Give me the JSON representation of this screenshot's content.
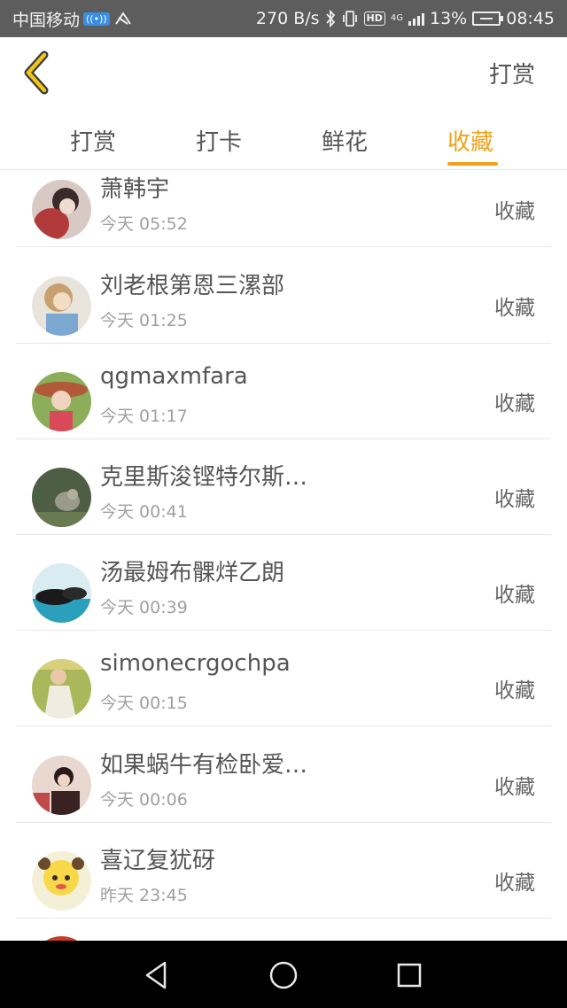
{
  "status_bar": {
    "carrier": "中国移动",
    "carrier_badge": "((•))",
    "speed": "270 B/s",
    "hd": "HD",
    "network": "4G",
    "battery": "13%",
    "time": "08:45"
  },
  "header": {
    "action_label": "打赏",
    "accent_color": "#f0a21b"
  },
  "tabs": [
    {
      "label": "打赏",
      "active": false
    },
    {
      "label": "打卡",
      "active": false
    },
    {
      "label": "鲜花",
      "active": false
    },
    {
      "label": "收藏",
      "active": true
    }
  ],
  "rows": [
    {
      "name": "萧韩宇",
      "time": "今天 05:52",
      "action": "收藏",
      "avatar_color": "#b23a3a"
    },
    {
      "name": "刘老根第恩三漯部",
      "time": "今天 01:25",
      "action": "收藏",
      "avatar_color": "#c9b39a"
    },
    {
      "name": "qgmaxmfara",
      "time": "今天 01:17",
      "action": "收藏",
      "avatar_color": "#7a9a4a"
    },
    {
      "name": "克里斯浚铿特尔斯…",
      "time": "今天 00:41",
      "action": "收藏",
      "avatar_color": "#4a5a3a"
    },
    {
      "name": "汤最姆布髁烊乙朗",
      "time": "今天 00:39",
      "action": "收藏",
      "avatar_color": "#2a9ab0"
    },
    {
      "name": "simonecrgochpa",
      "time": "今天 00:15",
      "action": "收藏",
      "avatar_color": "#8ea24a"
    },
    {
      "name": "如果蜗牛有检卧爱…",
      "time": "今天 00:06",
      "action": "收藏",
      "avatar_color": "#a84a4a"
    },
    {
      "name": "喜辽复犹砑",
      "time": "昨天 23:45",
      "action": "收藏",
      "avatar_color": "#f2d23a"
    }
  ]
}
